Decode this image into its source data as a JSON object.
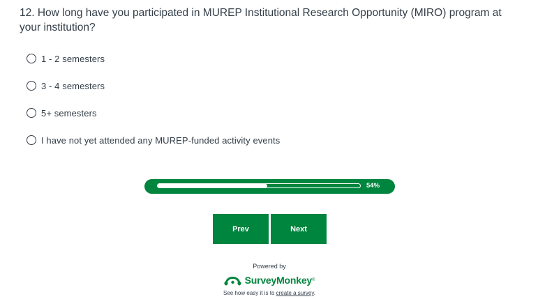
{
  "question": {
    "title": "12. How long have you participated in MUREP Institutional Research Opportunity (MIRO) program at your institution?",
    "options": [
      {
        "label": "1 - 2 semesters",
        "selected": false
      },
      {
        "label": "3 - 4 semesters",
        "selected": false
      },
      {
        "label": "5+ semesters",
        "selected": false
      },
      {
        "label": "I have not yet attended any MUREP-funded activity events",
        "selected": false
      }
    ]
  },
  "progress": {
    "percent": 54,
    "label": "54%"
  },
  "navigation": {
    "prev_label": "Prev",
    "next_label": "Next"
  },
  "footer": {
    "powered_by": "Powered by",
    "brand": "SurveyMonkey",
    "trademark": "®",
    "tagline_prefix": "See how easy it is to",
    "tagline_link": "create a survey",
    "tagline_suffix": "."
  },
  "colors": {
    "accent": "#00853e",
    "text": "#333e48",
    "background": "#ffffff"
  },
  "icons": {
    "radio": "radio-unchecked-icon",
    "logo": "surveymonkey-logo-icon"
  }
}
